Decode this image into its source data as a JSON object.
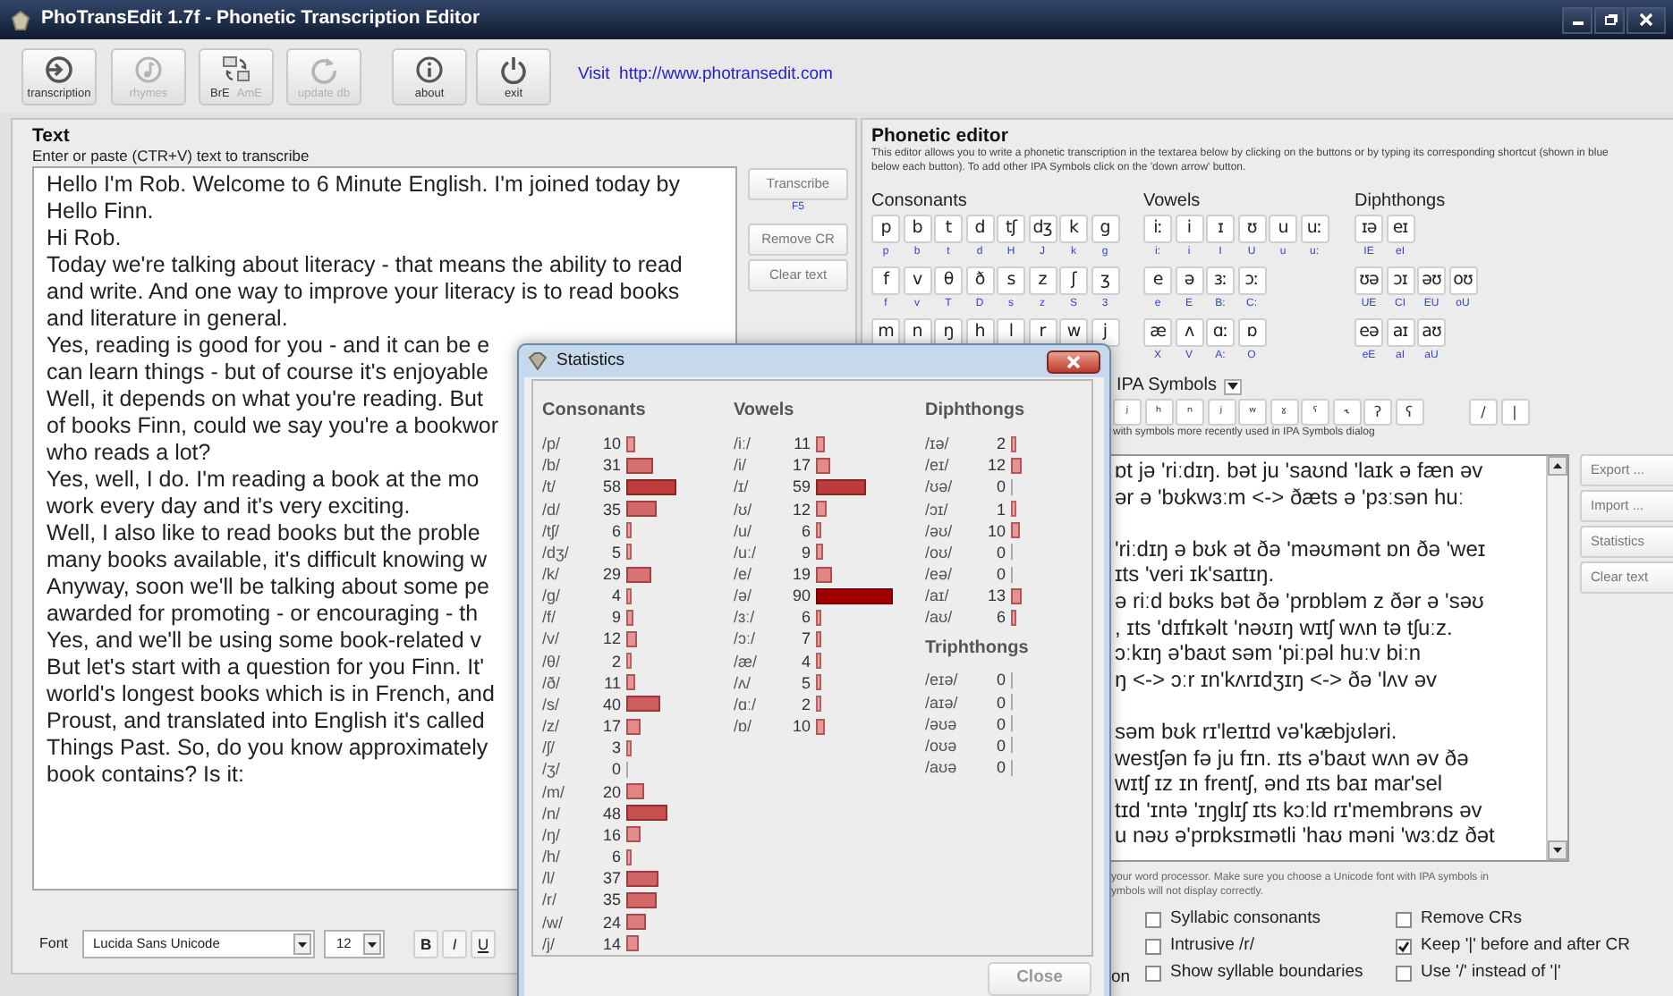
{
  "window": {
    "title": "PhoTransEdit 1.7f - Phonetic Transcription Editor"
  },
  "toolbar": [
    {
      "kind": "enter",
      "labels": [
        {
          "text": "transcription",
          "disabled": false
        }
      ]
    },
    {
      "kind": "note",
      "labels": [
        {
          "text": "rhymes",
          "disabled": true
        }
      ]
    },
    {
      "kind": "swap",
      "labels": [
        {
          "text": "BrE",
          "disabled": false
        },
        {
          "text": "AmE",
          "disabled": true
        }
      ]
    },
    {
      "kind": "refresh",
      "labels": [
        {
          "text": "update db",
          "disabled": true
        }
      ]
    },
    {
      "kind": "info",
      "labels": [
        {
          "text": "about",
          "disabled": false
        }
      ]
    },
    {
      "kind": "power",
      "labels": [
        {
          "text": "exit",
          "disabled": false
        }
      ]
    }
  ],
  "visit_link": "Visit  http://www.photransedit.com",
  "text_panel": {
    "title": "Text",
    "hint": "Enter or paste (CTR+V) text to transcribe",
    "lines": [
      "Hello I'm Rob. Welcome to 6 Minute English. I'm joined today by",
      "Hello Finn.",
      "Hi Rob.",
      "Today we're talking about literacy - that means the ability to read",
      "and write. And one way to improve your literacy is to read books",
      "and literature in general.",
      "Yes, reading is good for you - and it can be e",
      "can learn things - but of course it's enjoyable",
      "Well, it depends on what you're reading. But",
      "of books Finn, could we say you're a bookwor",
      "who reads a lot?",
      "Yes, well, I do. I'm reading a book at the mo",
      "work every day and it's very exciting.",
      "Well, I also like to read books but the proble",
      "many books available, it's difficult knowing w",
      "Anyway, soon we'll be talking about some pe",
      "awarded for promoting - or encouraging - th",
      "Yes, and we'll be using some book-related v",
      "But let's start with a question for you Finn. It'",
      "world's longest books which is in French, and",
      "Proust, and translated into English it's called",
      "Things Past. So, do you know approximately",
      "book contains? Is it:"
    ],
    "actions": [
      {
        "label": "Transcribe",
        "shortcut": "F5"
      },
      {
        "label": "Remove CR"
      },
      {
        "label": "Clear text"
      }
    ],
    "font": {
      "label": "Font",
      "family": "Lucida Sans Unicode",
      "size": "12",
      "styles": [
        "B",
        "I",
        "U"
      ]
    }
  },
  "phonetic_editor": {
    "title": "Phonetic editor",
    "description": "This editor allows you to write a phonetic transcription in the textarea below by clicking on the buttons or by typing its corresponding shortcut (shown in blue below each button). To add other IPA Symbols click on the 'down arrow' button.",
    "groups": [
      {
        "title": "Consonants",
        "rows": [
          [
            {
              "symbol": "p",
              "shortcut": "p"
            },
            {
              "symbol": "b",
              "shortcut": "b"
            },
            {
              "symbol": "t",
              "shortcut": "t"
            },
            {
              "symbol": "d",
              "shortcut": "d"
            },
            {
              "symbol": "tʃ",
              "shortcut": "H"
            },
            {
              "symbol": "dʒ",
              "shortcut": "J"
            },
            {
              "symbol": "k",
              "shortcut": "k"
            },
            {
              "symbol": "g",
              "shortcut": "g"
            }
          ],
          [
            {
              "symbol": "f",
              "shortcut": "f"
            },
            {
              "symbol": "v",
              "shortcut": "v"
            },
            {
              "symbol": "θ",
              "shortcut": "T"
            },
            {
              "symbol": "ð",
              "shortcut": "D"
            },
            {
              "symbol": "s",
              "shortcut": "s"
            },
            {
              "symbol": "z",
              "shortcut": "z"
            },
            {
              "symbol": "ʃ",
              "shortcut": "S"
            },
            {
              "symbol": "ʒ",
              "shortcut": "3"
            }
          ],
          [
            {
              "symbol": "m"
            },
            {
              "symbol": "n"
            },
            {
              "symbol": "ŋ"
            },
            {
              "symbol": "h"
            },
            {
              "symbol": "l"
            },
            {
              "symbol": "r"
            },
            {
              "symbol": "w"
            },
            {
              "symbol": "j"
            }
          ]
        ]
      },
      {
        "title": "Vowels",
        "rows": [
          [
            {
              "symbol": "iː",
              "shortcut": "i:"
            },
            {
              "symbol": "i",
              "shortcut": "i"
            },
            {
              "symbol": "ɪ",
              "shortcut": "I"
            },
            {
              "symbol": "ʊ",
              "shortcut": "U"
            },
            {
              "symbol": "u",
              "shortcut": "u"
            },
            {
              "symbol": "uː",
              "shortcut": "u:"
            }
          ],
          [
            {
              "symbol": "e",
              "shortcut": "e"
            },
            {
              "symbol": "ə",
              "shortcut": "E"
            },
            {
              "symbol": "ɜː",
              "shortcut": "B:"
            },
            {
              "symbol": "ɔː",
              "shortcut": "C:"
            }
          ],
          [
            {
              "symbol": "æ",
              "shortcut": "X"
            },
            {
              "symbol": "ʌ",
              "shortcut": "V"
            },
            {
              "symbol": "ɑː",
              "shortcut": "A:"
            },
            {
              "symbol": "ɒ",
              "shortcut": "O"
            }
          ]
        ]
      },
      {
        "title": "Diphthongs",
        "rows": [
          [
            {
              "symbol": "ɪə",
              "shortcut": "IE"
            },
            {
              "symbol": "eɪ",
              "shortcut": "eI"
            }
          ],
          [
            {
              "symbol": "ʊə",
              "shortcut": "UE"
            },
            {
              "symbol": "ɔɪ",
              "shortcut": "CI"
            },
            {
              "symbol": "əʊ",
              "shortcut": "EU"
            },
            {
              "symbol": "oʊ",
              "shortcut": "oU"
            }
          ],
          [
            {
              "symbol": "eə",
              "shortcut": "eE"
            },
            {
              "symbol": "aɪ",
              "shortcut": "aI"
            },
            {
              "symbol": "aʊ",
              "shortcut": "aU"
            }
          ]
        ]
      }
    ],
    "ipa_symbols": {
      "label": "IPA Symbols",
      "recent": [
        "ʲ",
        "ʰ",
        "ⁿ",
        "ʲ",
        "ʷ",
        "ˠ",
        "ˤ",
        "˞",
        "ʔ",
        "ʕ"
      ],
      "separators": [
        "/",
        "|"
      ],
      "caption": "with symbols more recently used in IPA Symbols dialog"
    },
    "paragraphs": [
      [
        "ɒt jə 'riːdɪŋ. bət ju 'saʊnd 'laɪk ə fæn əv",
        "ər ə 'bʊkwɜːm <-> ðæts ə 'pɜːsən huː"
      ],
      [
        "'riːdɪŋ ə bʊk ət ðə 'məʊmənt ɒn ðə 'weɪ",
        "ɪts 'veri ɪk'saɪtɪŋ.",
        "ə riːd bʊks bət ðə 'prɒbləm z ðər ə 'səʊ",
        ", ɪts 'dɪfɪkəlt 'nəʊɪŋ wɪtʃ wʌn tə tʃuːz.",
        "ɔːkɪŋ ə'baʊt səm 'piːpəl huːv biːn",
        "ŋ <-> ɔːr ɪn'kʌrɪdʒɪŋ <-> ðə 'lʌv əv"
      ],
      [
        "səm bʊk rɪ'leɪtɪd və'kæbjʊləri.",
        "westʃən fə ju fɪn. ɪts ə'baʊt wʌn əv ðə",
        "wɪtʃ ɪz ɪn frentʃ, ənd ɪts baɪ mar'sel",
        "tɪd 'ɪntə 'ɪŋglɪʃ ɪts kɔːld rɪ'membrəns əv",
        "u nəʊ ə'prɒksɪmətli 'haʊ məni 'wɜːdz ðət"
      ]
    ],
    "side_buttons": [
      "Export ...",
      "Import ...",
      "Statistics",
      "Clear text"
    ],
    "notes": [
      "your word processor. Make sure you choose a Unicode font with IPA symbols in",
      "ymbols will not display correctly."
    ],
    "cut_label": "on",
    "options": [
      {
        "label": "Syllabic consonants",
        "checked": false
      },
      {
        "label": "Remove CRs",
        "checked": false
      },
      {
        "label": "Intrusive /r/",
        "checked": false
      },
      {
        "label": "Keep '|' before and after CR",
        "checked": true
      },
      {
        "label": "Show syllable boundaries",
        "checked": false
      },
      {
        "label": "Use '/' instead of '|'",
        "checked": false
      }
    ]
  },
  "statistics": {
    "title": "Statistics",
    "close": "Close",
    "columns": [
      {
        "groups": [
          {
            "title": "Consonants",
            "rows": [
              {
                "symbol": "/p/",
                "count": "10"
              },
              {
                "symbol": "/b/",
                "count": "31"
              },
              {
                "symbol": "/t/",
                "count": "58"
              },
              {
                "symbol": "/d/",
                "count": "35"
              },
              {
                "symbol": "/tʃ/",
                "count": "6"
              },
              {
                "symbol": "/dʒ/",
                "count": "5"
              },
              {
                "symbol": "/k/",
                "count": "29"
              },
              {
                "symbol": "/g/",
                "count": "4"
              },
              {
                "symbol": "/f/",
                "count": "9"
              },
              {
                "symbol": "/v/",
                "count": "12"
              },
              {
                "symbol": "/θ/",
                "count": "2"
              },
              {
                "symbol": "/ð/",
                "count": "11"
              },
              {
                "symbol": "/s/",
                "count": "40"
              },
              {
                "symbol": "/z/",
                "count": "17"
              },
              {
                "symbol": "/ʃ/",
                "count": "3"
              },
              {
                "symbol": "/ʒ/",
                "count": "0"
              },
              {
                "symbol": "/m/",
                "count": "20"
              },
              {
                "symbol": "/n/",
                "count": "48"
              },
              {
                "symbol": "/ŋ/",
                "count": "16"
              },
              {
                "symbol": "/h/",
                "count": "6"
              },
              {
                "symbol": "/l/",
                "count": "37"
              },
              {
                "symbol": "/r/",
                "count": "35"
              },
              {
                "symbol": "/w/",
                "count": "24"
              },
              {
                "symbol": "/j/",
                "count": "14"
              }
            ]
          }
        ]
      },
      {
        "groups": [
          {
            "title": "Vowels",
            "rows": [
              {
                "symbol": "/iː/",
                "count": "11"
              },
              {
                "symbol": "/i/",
                "count": "17"
              },
              {
                "symbol": "/ɪ/",
                "count": "59"
              },
              {
                "symbol": "/ʊ/",
                "count": "12"
              },
              {
                "symbol": "/u/",
                "count": "6"
              },
              {
                "symbol": "/uː/",
                "count": "9"
              },
              {
                "symbol": "/e/",
                "count": "19"
              },
              {
                "symbol": "/ə/",
                "count": "90"
              },
              {
                "symbol": "/ɜː/",
                "count": "6"
              },
              {
                "symbol": "/ɔː/",
                "count": "7"
              },
              {
                "symbol": "/æ/",
                "count": "4"
              },
              {
                "symbol": "/ʌ/",
                "count": "5"
              },
              {
                "symbol": "/ɑː/",
                "count": "2"
              },
              {
                "symbol": "/ɒ/",
                "count": "10"
              }
            ]
          }
        ]
      },
      {
        "groups": [
          {
            "title": "Diphthongs",
            "rows": [
              {
                "symbol": "/ɪə/",
                "count": "2"
              },
              {
                "symbol": "/eɪ/",
                "count": "12"
              },
              {
                "symbol": "/ʊə/",
                "count": "0"
              },
              {
                "symbol": "/ɔɪ/",
                "count": "1"
              },
              {
                "symbol": "/əʊ/",
                "count": "10"
              },
              {
                "symbol": "/oʊ/",
                "count": "0"
              },
              {
                "symbol": "/eə/",
                "count": "0"
              },
              {
                "symbol": "/aɪ/",
                "count": "13"
              },
              {
                "symbol": "/aʊ/",
                "count": "6"
              }
            ]
          },
          {
            "title": "Triphthongs",
            "rows": [
              {
                "symbol": "/eɪə/",
                "count": "0"
              },
              {
                "symbol": "/aɪə/",
                "count": "0"
              },
              {
                "symbol": "/əʊə",
                "count": "0"
              },
              {
                "symbol": "/oʊə",
                "count": "0"
              },
              {
                "symbol": "/aʊə",
                "count": "0"
              }
            ]
          }
        ]
      }
    ]
  }
}
